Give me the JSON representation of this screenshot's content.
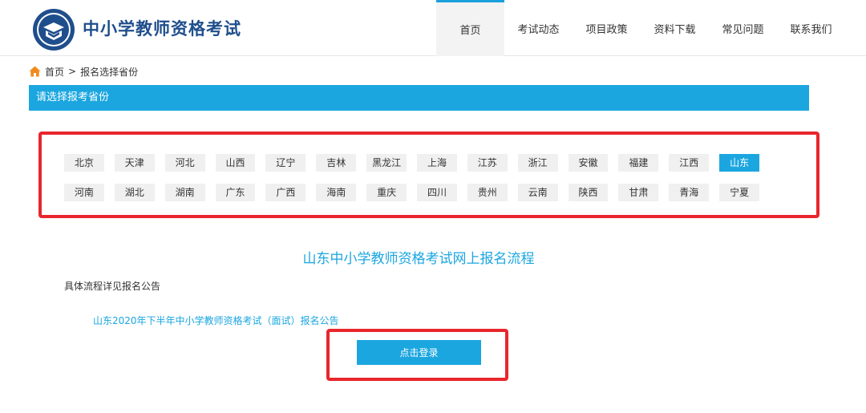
{
  "header": {
    "site_title": "中小学教师资格考试",
    "nav": [
      "首页",
      "考试动态",
      "项目政策",
      "资料下载",
      "常见问题",
      "联系我们"
    ],
    "active_nav_index": 0
  },
  "breadcrumb": {
    "home": "首页",
    "separator": ">",
    "current": "报名选择省份"
  },
  "section": {
    "title": "请选择报考省份"
  },
  "provinces": {
    "row1": [
      "北京",
      "天津",
      "河北",
      "山西",
      "辽宁",
      "吉林",
      "黑龙江",
      "上海",
      "江苏",
      "浙江",
      "安徽",
      "福建",
      "江西",
      "山东"
    ],
    "row2": [
      "河南",
      "湖北",
      "湖南",
      "广东",
      "广西",
      "海南",
      "重庆",
      "四川",
      "贵州",
      "云南",
      "陕西",
      "甘肃",
      "青海",
      "宁夏"
    ],
    "selected": "山东"
  },
  "flow": {
    "title": "山东中小学教师资格考试网上报名流程",
    "note": "具体流程详见报名公告",
    "notice_link": "山东2020年下半年中小学教师资格考试（面试）报名公告"
  },
  "login": {
    "button_label": "点击登录"
  },
  "colors": {
    "accent": "#1ba6e0",
    "highlight_border": "#e8262c",
    "brand": "#1f4e8c"
  }
}
